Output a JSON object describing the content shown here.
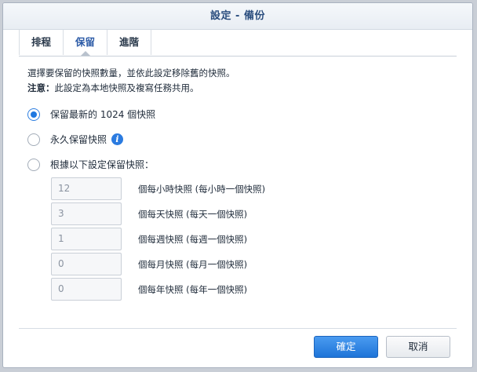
{
  "dialog": {
    "title": "設定 - 備份"
  },
  "tabs": [
    {
      "label": "排程",
      "active": false
    },
    {
      "label": "保留",
      "active": true
    },
    {
      "label": "進階",
      "active": false
    }
  ],
  "retention": {
    "description": "選擇要保留的快照數量，並依此設定移除舊的快照。",
    "note_label": "注意：",
    "note_text": "此設定為本地快照及複寫任務共用。",
    "options": [
      {
        "label": "保留最新的 1024 個快照",
        "checked": true
      },
      {
        "label": "永久保留快照",
        "checked": false,
        "icon": "info-icon"
      },
      {
        "label": "根據以下設定保留快照：",
        "checked": false
      }
    ],
    "fields": [
      {
        "value": "12",
        "label": "個每小時快照 (每小時一個快照)"
      },
      {
        "value": "3",
        "label": "個每天快照 (每天一個快照)"
      },
      {
        "value": "1",
        "label": "個每週快照 (每週一個快照)"
      },
      {
        "value": "0",
        "label": "個每月快照 (每月一個快照)"
      },
      {
        "value": "0",
        "label": "個每年快照 (每年一個快照)"
      }
    ]
  },
  "footer": {
    "ok_label": "確定",
    "cancel_label": "取消"
  },
  "colors": {
    "accent": "#1f78e0",
    "title": "#2a4d7e"
  }
}
